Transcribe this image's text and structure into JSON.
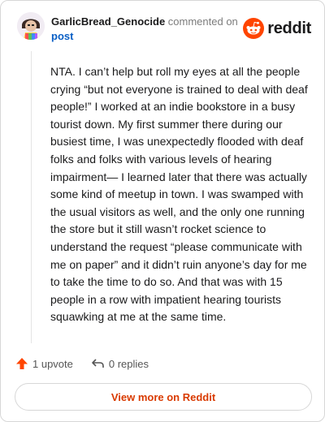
{
  "comment": {
    "username": "GarlicBread_Genocide",
    "action_text": "commented on",
    "post_link": "post",
    "body": "NTA. I can’t help but roll my eyes at all the people crying “but not everyone is trained to deal with deaf people!” I worked at an indie bookstore in a busy tourist down. My first summer there during our busiest time, I was unexpectedly flooded with deaf folks and folks with various levels of hearing impairment— I learned later that there was actually some kind of meetup in town. I was swamped with the usual visitors as well, and the only one running the store but it still wasn’t rocket science to understand the request “please communicate with me on paper” and it didn’t ruin anyone’s day for me to take the time to do so. And that was with 15 people in a row with impatient hearing tourists squawking at me at the same time.",
    "upvotes_label": "1 upvote",
    "replies_label": "0 replies"
  },
  "brand": {
    "name": "reddit",
    "icon": "reddit-snoo-icon",
    "color": "#ff4500"
  },
  "footer": {
    "view_more_label": "View more on Reddit"
  },
  "icons": {
    "upvote": "upvote-arrow-icon",
    "reply": "reply-arrow-icon",
    "avatar": "avatar"
  },
  "colors": {
    "accent": "#d93a00",
    "upvote": "#ff4500",
    "link": "#0a5fc5"
  }
}
